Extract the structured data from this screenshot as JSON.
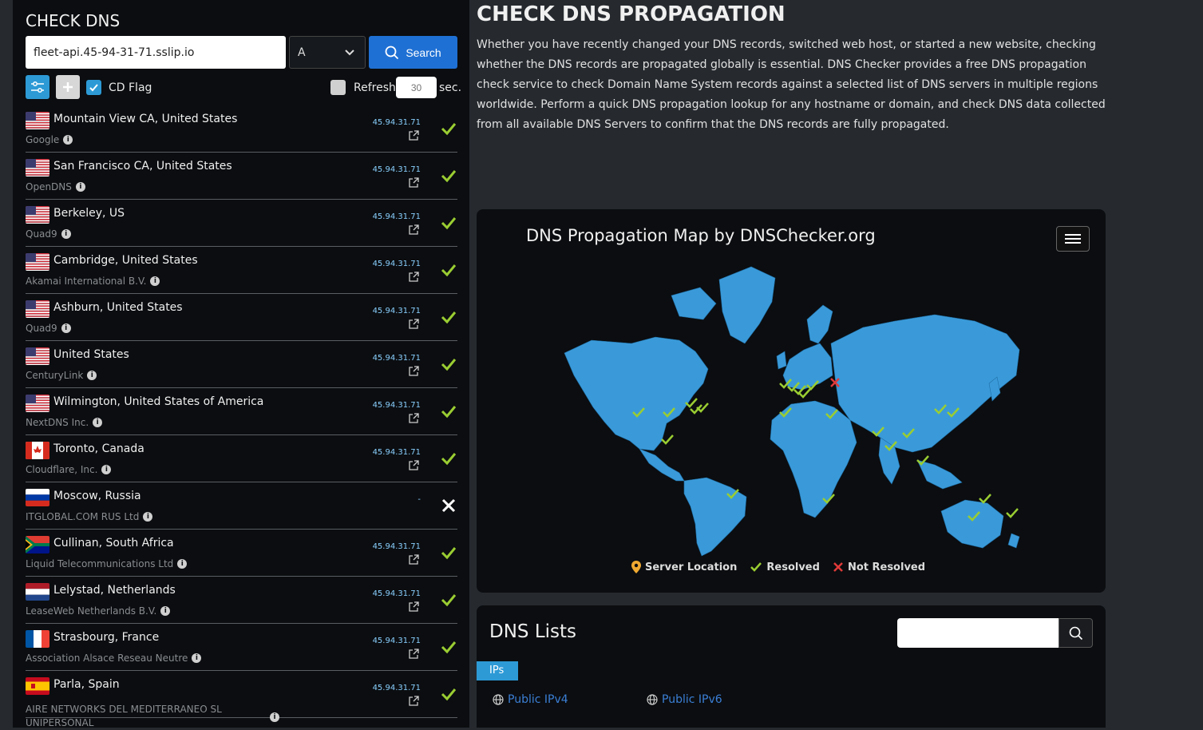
{
  "check_dns": {
    "title": "CHECK DNS",
    "domain_value": "fleet-api.45-94-31-71.sslip.io",
    "record_type": "A",
    "search_label": "Search",
    "cd_flag_label": "CD Flag",
    "refresh_label": "Refresh:",
    "refresh_placeholder": "30",
    "sec_label": "sec."
  },
  "servers": [
    {
      "location": "Mountain View CA, United States",
      "provider": "Google",
      "ip": "45.94.31.71",
      "status": "resolved",
      "flag": "us"
    },
    {
      "location": "San Francisco CA, United States",
      "provider": "OpenDNS",
      "ip": "45.94.31.71",
      "status": "resolved",
      "flag": "us"
    },
    {
      "location": "Berkeley, US",
      "provider": "Quad9",
      "ip": "45.94.31.71",
      "status": "resolved",
      "flag": "us"
    },
    {
      "location": "Cambridge, United States",
      "provider": "Akamai International B.V.",
      "ip": "45.94.31.71",
      "status": "resolved",
      "flag": "us"
    },
    {
      "location": "Ashburn, United States",
      "provider": "Quad9",
      "ip": "45.94.31.71",
      "status": "resolved",
      "flag": "us"
    },
    {
      "location": "United States",
      "provider": "CenturyLink",
      "ip": "45.94.31.71",
      "status": "resolved",
      "flag": "us"
    },
    {
      "location": "Wilmington, United States of America",
      "provider": "NextDNS Inc.",
      "ip": "45.94.31.71",
      "status": "resolved",
      "flag": "us"
    },
    {
      "location": "Toronto, Canada",
      "provider": "Cloudflare, Inc.",
      "ip": "45.94.31.71",
      "status": "resolved",
      "flag": "ca"
    },
    {
      "location": "Moscow, Russia",
      "provider": "ITGLOBAL.COM RUS Ltd",
      "ip": "-",
      "status": "failed",
      "flag": "ru"
    },
    {
      "location": "Cullinan, South Africa",
      "provider": "Liquid Telecommunications Ltd",
      "ip": "45.94.31.71",
      "status": "resolved",
      "flag": "za"
    },
    {
      "location": "Lelystad, Netherlands",
      "provider": "LeaseWeb Netherlands B.V.",
      "ip": "45.94.31.71",
      "status": "resolved",
      "flag": "nl"
    },
    {
      "location": "Strasbourg, France",
      "provider": "Association Alsace Reseau Neutre",
      "ip": "45.94.31.71",
      "status": "resolved",
      "flag": "fr"
    },
    {
      "location": "Parla, Spain",
      "provider": "AIRE NETWORKS DEL MEDITERRANEO SL UNIPERSONAL",
      "ip": "45.94.31.71",
      "status": "resolved",
      "flag": "es"
    }
  ],
  "propagation": {
    "title": "CHECK DNS PROPAGATION",
    "description": "Whether you have recently changed your DNS records, switched web host, or started a new website, checking whether the DNS records are propagated globally is essential. DNS Checker provides a free DNS propagation check service to check Domain Name System records against a selected list of DNS servers in multiple regions worldwide. Perform a quick DNS propagation lookup for any hostname or domain, and check DNS data collected from all available DNS Servers to confirm that the DNS records are fully propagated."
  },
  "map": {
    "title": "DNS Propagation Map by DNSChecker.org",
    "legend_server": "Server Location",
    "legend_resolved": "Resolved",
    "legend_not_resolved": "Not Resolved"
  },
  "dns_lists": {
    "title": "DNS Lists",
    "tab": "IPs",
    "ipv4": "Public IPv4",
    "ipv6": "Public IPv6"
  },
  "colors": {
    "accent": "#2d9ad6",
    "button": "#1f70d4",
    "resolved": "#9acd32",
    "failed": "#e03a3a",
    "land": "#3a9ad9"
  }
}
